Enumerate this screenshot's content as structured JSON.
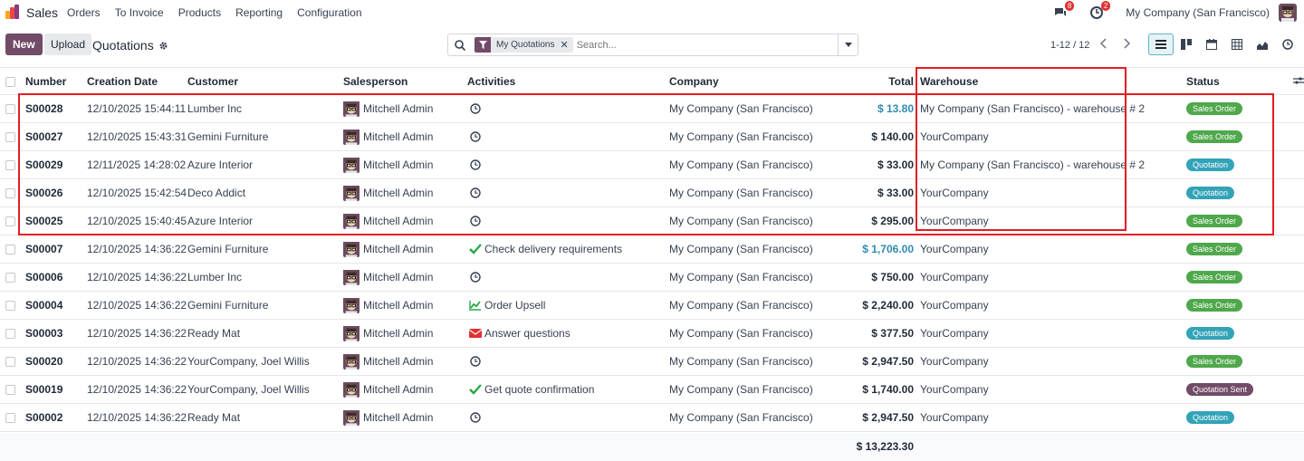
{
  "navbar": {
    "app_name": "Sales",
    "menu": [
      "Orders",
      "To Invoice",
      "Products",
      "Reporting",
      "Configuration"
    ],
    "messages_count": "8",
    "activities_count": "2",
    "company": "My Company (San Francisco)"
  },
  "control": {
    "new_label": "New",
    "upload_label": "Upload",
    "breadcrumb": "Quotations",
    "facet_label": "My Quotations",
    "search_placeholder": "Search...",
    "pager": "1-12 / 12"
  },
  "columns": {
    "number": "Number",
    "creation_date": "Creation Date",
    "customer": "Customer",
    "salesperson": "Salesperson",
    "activities": "Activities",
    "company": "Company",
    "total": "Total",
    "warehouse": "Warehouse",
    "status": "Status"
  },
  "rows": [
    {
      "number": "S00028",
      "date": "12/10/2025 15:44:11",
      "customer": "Lumber Inc",
      "salesperson": "Mitchell Admin",
      "activity": "",
      "activity_icon": "clock-icon",
      "company": "My Company (San Francisco)",
      "total": "$ 13.80",
      "total_color": "blue",
      "warehouse": "My Company (San Francisco) - warehouse # 2",
      "status": "Sales Order",
      "status_color": "#4fa84b"
    },
    {
      "number": "S00027",
      "date": "12/10/2025 15:43:31",
      "customer": "Gemini Furniture",
      "salesperson": "Mitchell Admin",
      "activity": "",
      "activity_icon": "clock-icon",
      "company": "My Company (San Francisco)",
      "total": "$ 140.00",
      "total_color": "dark",
      "warehouse": "YourCompany",
      "status": "Sales Order",
      "status_color": "#4fa84b"
    },
    {
      "number": "S00029",
      "date": "12/11/2025 14:28:02",
      "customer": "Azure Interior",
      "salesperson": "Mitchell Admin",
      "activity": "",
      "activity_icon": "clock-icon",
      "company": "My Company (San Francisco)",
      "total": "$ 33.00",
      "total_color": "dark",
      "warehouse": "My Company (San Francisco) - warehouse # 2",
      "status": "Quotation",
      "status_color": "#33a3b8"
    },
    {
      "number": "S00026",
      "date": "12/10/2025 15:42:54",
      "customer": "Deco Addict",
      "salesperson": "Mitchell Admin",
      "activity": "",
      "activity_icon": "clock-icon",
      "company": "My Company (San Francisco)",
      "total": "$ 33.00",
      "total_color": "dark",
      "warehouse": "YourCompany",
      "status": "Quotation",
      "status_color": "#33a3b8"
    },
    {
      "number": "S00025",
      "date": "12/10/2025 15:40:45",
      "customer": "Azure Interior",
      "salesperson": "Mitchell Admin",
      "activity": "",
      "activity_icon": "clock-icon",
      "company": "My Company (San Francisco)",
      "total": "$ 295.00",
      "total_color": "dark",
      "warehouse": "YourCompany",
      "status": "Sales Order",
      "status_color": "#4fa84b"
    },
    {
      "number": "S00007",
      "date": "12/10/2025 14:36:22",
      "customer": "Gemini Furniture",
      "salesperson": "Mitchell Admin",
      "activity": "Check delivery requirements",
      "activity_icon": "check-icon",
      "company": "My Company (San Francisco)",
      "total": "$ 1,706.00",
      "total_color": "blue",
      "warehouse": "YourCompany",
      "status": "Sales Order",
      "status_color": "#4fa84b"
    },
    {
      "number": "S00006",
      "date": "12/10/2025 14:36:22",
      "customer": "Lumber Inc",
      "salesperson": "Mitchell Admin",
      "activity": "",
      "activity_icon": "clock-icon",
      "company": "My Company (San Francisco)",
      "total": "$ 750.00",
      "total_color": "dark",
      "warehouse": "YourCompany",
      "status": "Sales Order",
      "status_color": "#4fa84b"
    },
    {
      "number": "S00004",
      "date": "12/10/2025 14:36:22",
      "customer": "Gemini Furniture",
      "salesperson": "Mitchell Admin",
      "activity": "Order Upsell",
      "activity_icon": "chart-icon",
      "company": "My Company (San Francisco)",
      "total": "$ 2,240.00",
      "total_color": "dark",
      "warehouse": "YourCompany",
      "status": "Sales Order",
      "status_color": "#4fa84b"
    },
    {
      "number": "S00003",
      "date": "12/10/2025 14:36:22",
      "customer": "Ready Mat",
      "salesperson": "Mitchell Admin",
      "activity": "Answer questions",
      "activity_icon": "envelope-icon",
      "company": "My Company (San Francisco)",
      "total": "$ 377.50",
      "total_color": "dark",
      "warehouse": "YourCompany",
      "status": "Quotation",
      "status_color": "#33a3b8"
    },
    {
      "number": "S00020",
      "date": "12/10/2025 14:36:22",
      "customer": "YourCompany, Joel Willis",
      "salesperson": "Mitchell Admin",
      "activity": "",
      "activity_icon": "clock-icon",
      "company": "My Company (San Francisco)",
      "total": "$ 2,947.50",
      "total_color": "dark",
      "warehouse": "YourCompany",
      "status": "Sales Order",
      "status_color": "#4fa84b"
    },
    {
      "number": "S00019",
      "date": "12/10/2025 14:36:22",
      "customer": "YourCompany, Joel Willis",
      "salesperson": "Mitchell Admin",
      "activity": "Get quote confirmation",
      "activity_icon": "check-icon",
      "company": "My Company (San Francisco)",
      "total": "$ 1,740.00",
      "total_color": "dark",
      "warehouse": "YourCompany",
      "status": "Quotation Sent",
      "status_color": "#714b67"
    },
    {
      "number": "S00002",
      "date": "12/10/2025 14:36:22",
      "customer": "Ready Mat",
      "salesperson": "Mitchell Admin",
      "activity": "",
      "activity_icon": "clock-icon",
      "company": "My Company (San Francisco)",
      "total": "$ 2,947.50",
      "total_color": "dark",
      "warehouse": "YourCompany",
      "status": "Quotation",
      "status_color": "#33a3b8"
    }
  ],
  "footer": {
    "grand_total": "$ 13,223.30"
  },
  "colors": {
    "brand": "#714b67",
    "highlight": "#e11d24",
    "link_blue": "#2f8bb3"
  }
}
